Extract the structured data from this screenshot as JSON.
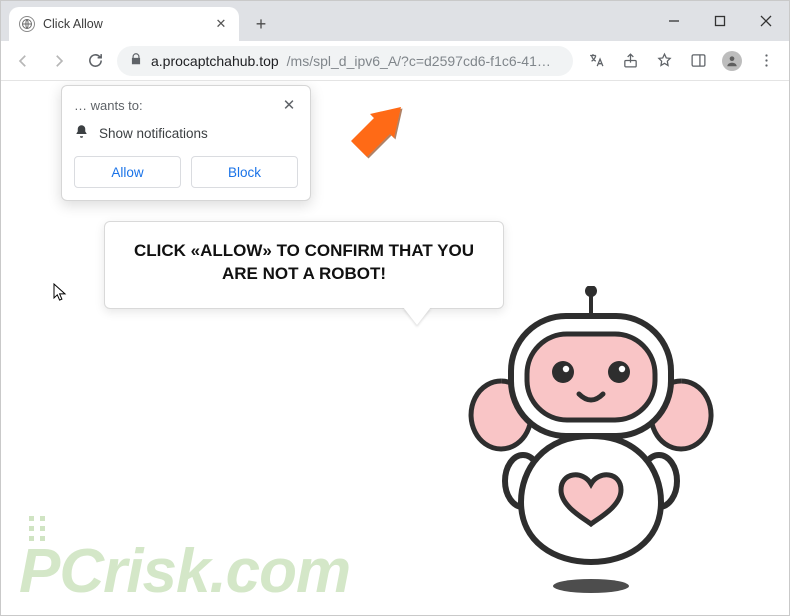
{
  "browser": {
    "tab": {
      "title": "Click Allow"
    },
    "address": {
      "domain": "a.procaptchahub.top",
      "path": "/ms/spl_d_ipv6_A/?c=d2597cd6-f1c6-41…"
    }
  },
  "permission": {
    "wants": "… wants to:",
    "line": "Show notifications",
    "allow": "Allow",
    "block": "Block"
  },
  "page": {
    "bubble_line1": "CLICK «ALLOW» TO CONFIRM THAT YOU",
    "bubble_line2": "ARE NOT A ROBOT!"
  },
  "watermark": {
    "text_pc": "PC",
    "text_rest": "risk.com"
  },
  "colors": {
    "accent_blue": "#1a73e8",
    "arrow": "#ff6a13",
    "robot_body": "#f9c5c6",
    "robot_dark": "#2e2e2e"
  }
}
